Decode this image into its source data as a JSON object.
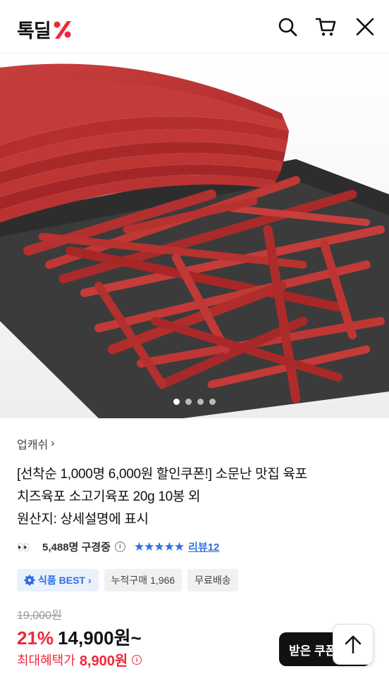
{
  "header": {
    "logo_text": "톡딜",
    "brand_color": "#f0283b"
  },
  "gallery": {
    "dot_count": 4,
    "active_index": 0
  },
  "product": {
    "brand": "업캐쉬",
    "brand_chevron": "›",
    "title_line1": "[선착순 1,000명 6,000원 할인쿠폰!] 소문난 맛집 육포",
    "title_line2": "치즈육포 소고기육포 20g 10봉 외",
    "origin": "원산지: 상세설명에 표시"
  },
  "stats": {
    "viewers": "5,488명 구경중",
    "stars": "★★★★★",
    "review": "리뷰12"
  },
  "badges": {
    "best": "식품 BEST",
    "sold": "누적구매 1,966",
    "shipping": "무료배송"
  },
  "price": {
    "original": "19,000원",
    "discount": "21%",
    "current": "14,900원~",
    "max_label": "최대혜택가",
    "max_price": "8,900원"
  },
  "actions": {
    "coupon": "받은 쿠폰"
  },
  "colors": {
    "accent_red": "#f0283b",
    "accent_blue": "#2f6de1"
  }
}
